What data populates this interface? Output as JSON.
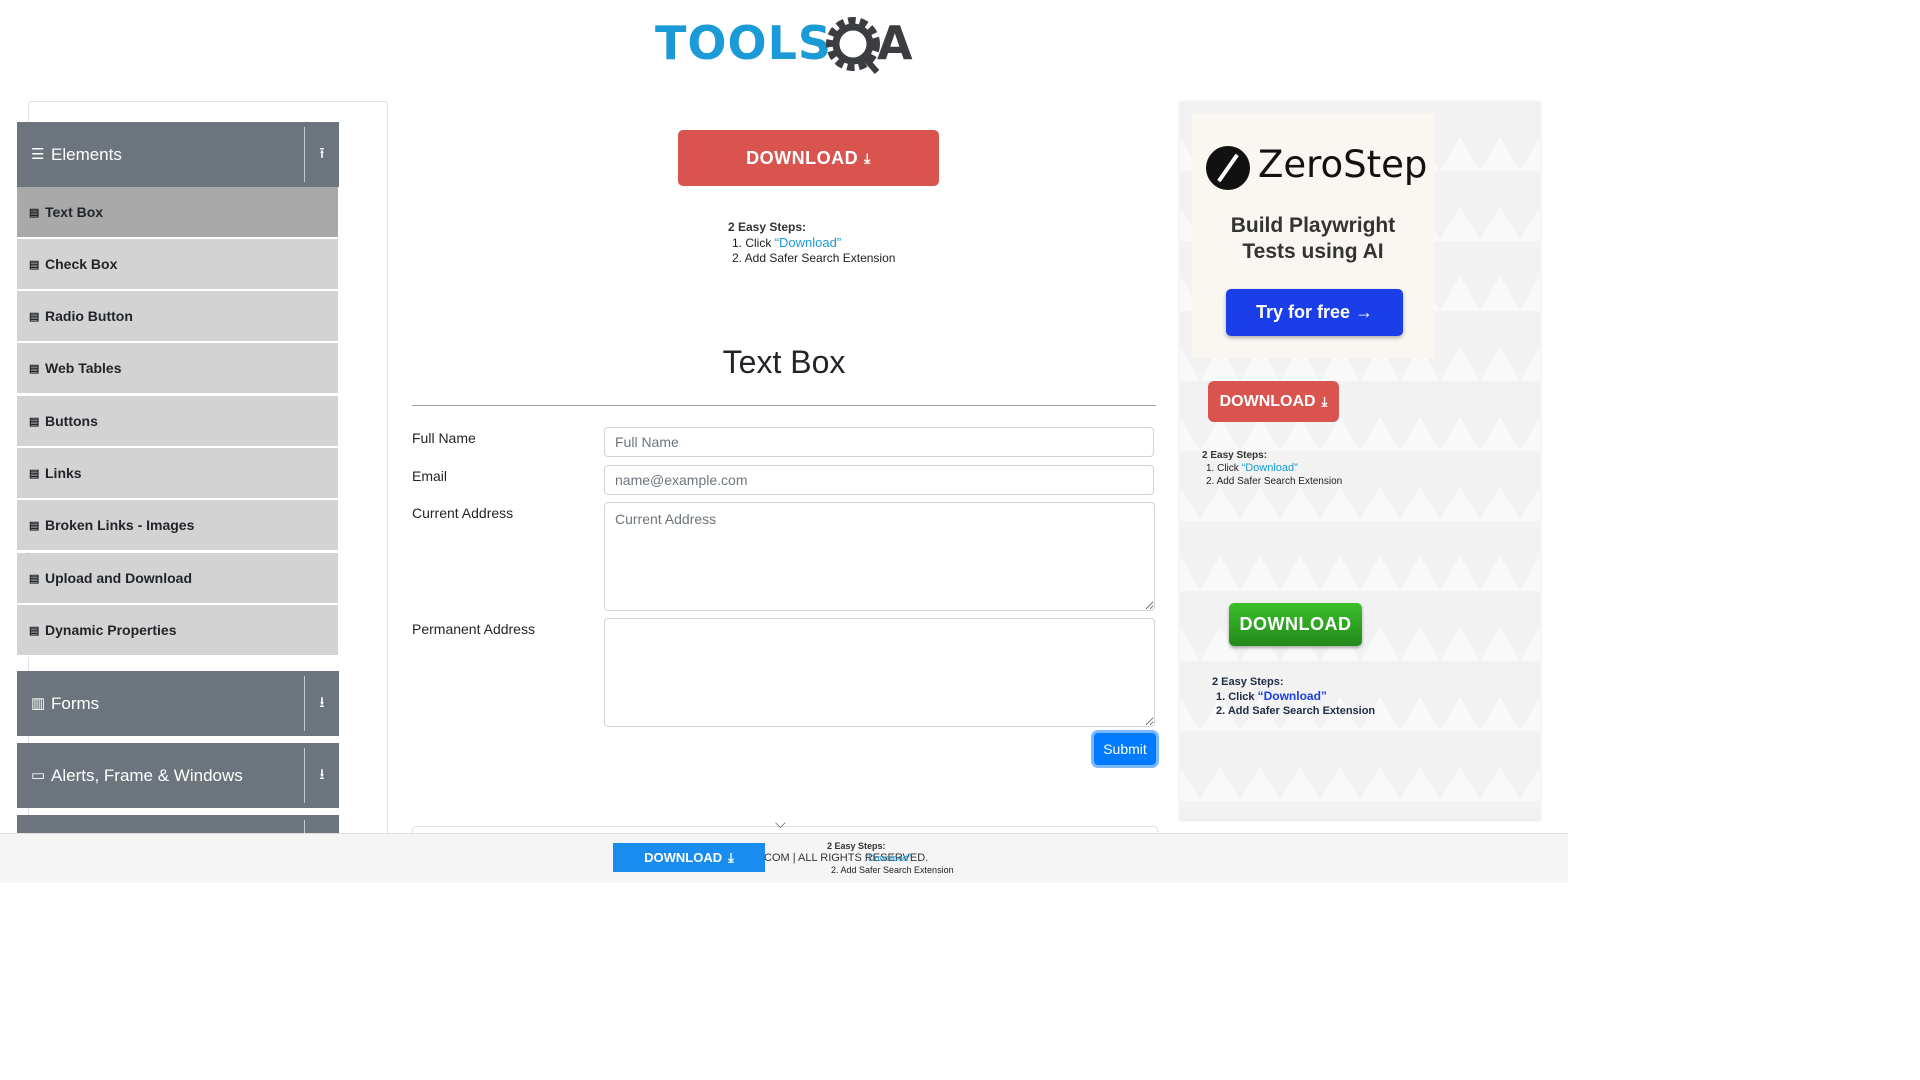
{
  "logo": {
    "tools": "TOOLS",
    "a": "A"
  },
  "sidebar": {
    "groups": [
      {
        "title": "Elements",
        "icon": "list-icon",
        "arrow": "collapse-up-icon"
      },
      {
        "title": "Forms",
        "icon": "form-icon",
        "arrow": "expand-down-icon"
      },
      {
        "title": "Alerts, Frame & Windows",
        "icon": "window-icon",
        "arrow": "expand-down-icon"
      }
    ],
    "items": [
      {
        "label": "Text Box",
        "active": true
      },
      {
        "label": "Check Box"
      },
      {
        "label": "Radio Button"
      },
      {
        "label": "Web Tables"
      },
      {
        "label": "Buttons"
      },
      {
        "label": "Links"
      },
      {
        "label": "Broken Links - Images"
      },
      {
        "label": "Upload and Download"
      },
      {
        "label": "Dynamic Properties"
      }
    ]
  },
  "ad_center": {
    "download_label": "DOWNLOAD",
    "steps_heading": "2 Easy Steps:",
    "step1_prefix": "1. Click ",
    "step1_link": "“Download”",
    "step2": "2. Add Safer Search Extension"
  },
  "main": {
    "title": "Text Box",
    "fields": {
      "full_name_label": "Full Name",
      "full_name_placeholder": "Full Name",
      "email_label": "Email",
      "email_placeholder": "name@example.com",
      "current_address_label": "Current Address",
      "current_address_placeholder": "Current Address",
      "permanent_address_label": "Permanent Address"
    },
    "submit_label": "Submit"
  },
  "ad_right": {
    "zerostep_name": "ZeroStep",
    "zerostep_tagline_1": "Build Playwright",
    "zerostep_tagline_2": "Tests using AI",
    "zerostep_cta": "Try for free →",
    "download_red": "DOWNLOAD",
    "steps_heading": "2 Easy Steps:",
    "step1_prefix": "1. Click ",
    "step1_link": "“Download”",
    "step2": "2. Add Safer Search Extension",
    "download_green": "DOWNLOAD",
    "steps2_heading": "2 Easy Steps:",
    "steps2_step1_prefix": "1. Click ",
    "steps2_step1_link": "“Download”",
    "steps2_step2": "2. Add Safer Search Extension"
  },
  "footer": {
    "download_label": "DOWNLOAD",
    "copyright": "COM | ALL RIGHTS RESERVED.",
    "steps_heading": "2 Easy Steps:",
    "step1_link": "“Download”",
    "step2": "2. Add Safer Search Extension"
  },
  "colors": {
    "brand_blue": "#1a9ad6",
    "sidebar_header": "#6c757d",
    "download_red": "#d9534f",
    "submit_blue": "#007bff"
  }
}
